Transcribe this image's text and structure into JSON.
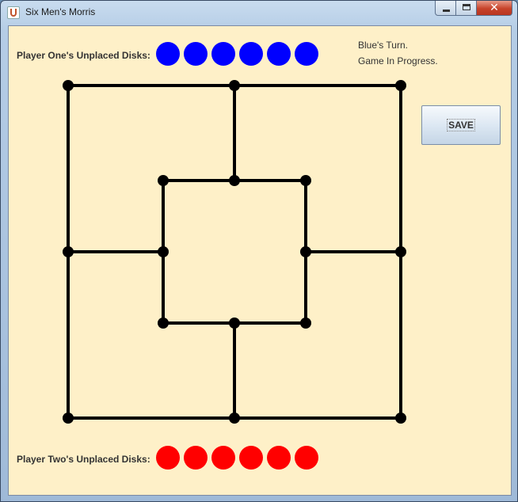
{
  "window": {
    "title": "Six Men's Morris",
    "close_glyph": "✕"
  },
  "game": {
    "player_one_label": "Player One's Unplaced Disks:",
    "player_two_label": "Player Two's Unplaced Disks:",
    "player_one_unplaced": 6,
    "player_two_unplaced": 6,
    "player_one_color": "#0000ff",
    "player_two_color": "#ff0000",
    "turn_text": "Blue's Turn.",
    "state_text": "Game In Progress.",
    "save_label": "SAVE"
  },
  "board": {
    "line_color": "#000000",
    "node_color": "#000000"
  }
}
